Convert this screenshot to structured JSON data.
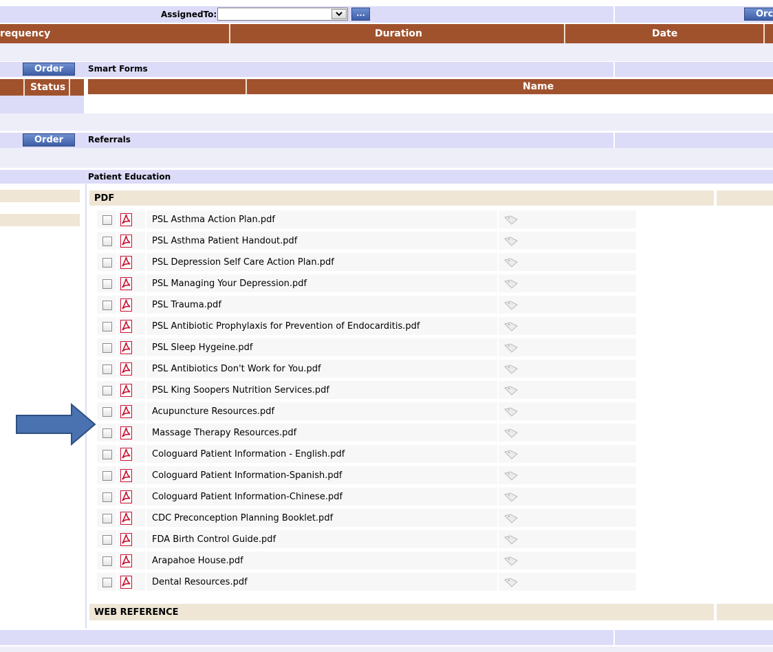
{
  "top_bar": {
    "assigned_to_label": "AssignedTo:",
    "assigned_to_value": "",
    "ellipsis_label": "...",
    "order_right_label": "Orc"
  },
  "orders_table": {
    "columns": [
      "requency",
      "Duration",
      "Date"
    ]
  },
  "smart_forms": {
    "order_label": "Order",
    "title": "Smart Forms",
    "status_header": "Status",
    "name_header": "Name"
  },
  "referrals": {
    "order_label": "Order",
    "title": "Referrals"
  },
  "patient_education": {
    "title": "Patient Education",
    "pdf_group_label": "PDF",
    "web_group_label": "WEB REFERENCE",
    "documents": [
      "PSL Asthma Action Plan.pdf",
      "PSL Asthma Patient Handout.pdf",
      "PSL Depression Self Care Action Plan.pdf",
      "PSL Managing Your Depression.pdf",
      "PSL Trauma.pdf",
      "PSL Antibiotic Prophylaxis for Prevention of Endocarditis.pdf",
      "PSL Sleep Hygeine.pdf",
      "PSL Antibiotics Don't Work for You.pdf",
      "PSL King Soopers Nutrition Services.pdf",
      "Acupuncture Resources.pdf",
      "Massage Therapy Resources.pdf",
      "Cologuard Patient Information - English.pdf",
      "Cologuard Patient Information-Spanish.pdf",
      "Cologuard Patient Information-Chinese.pdf",
      "CDC Preconception Planning Booklet.pdf",
      "FDA Birth Control Guide.pdf",
      "Arapahoe House.pdf",
      "Dental Resources.pdf"
    ]
  },
  "annotation": {
    "arrow_color": "#4a72b0"
  }
}
